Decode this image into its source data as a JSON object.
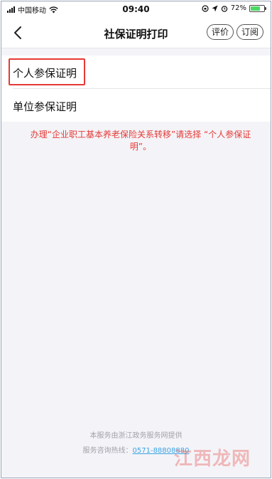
{
  "status_bar": {
    "carrier": "中国移动",
    "time": "09:40",
    "battery_percent": "72%",
    "battery_level": 0.72,
    "icons": [
      "signal-icon",
      "wifi-icon",
      "rotation-lock-icon",
      "location-icon",
      "alarm-icon",
      "battery-icon"
    ]
  },
  "nav": {
    "title": "社保证明打印",
    "rate_label": "评价",
    "subscribe_label": "订阅",
    "back_icon": "chevron-left-icon"
  },
  "list": {
    "items": [
      {
        "label": "个人参保证明",
        "highlighted": true
      },
      {
        "label": "单位参保证明",
        "highlighted": false
      }
    ]
  },
  "notice": "办理“企业职工基本养老保险关系转移”请选择 “个人参保证明”。",
  "footer": {
    "provider": "本服务由浙江政务服务网提供",
    "hotline_label": "服务咨询热线：",
    "hotline_number": "0571-88808880"
  },
  "watermark": "江西龙网",
  "colors": {
    "accent_red": "#e53935",
    "link_blue": "#3aa3e3",
    "background": "#f4f4f8"
  }
}
